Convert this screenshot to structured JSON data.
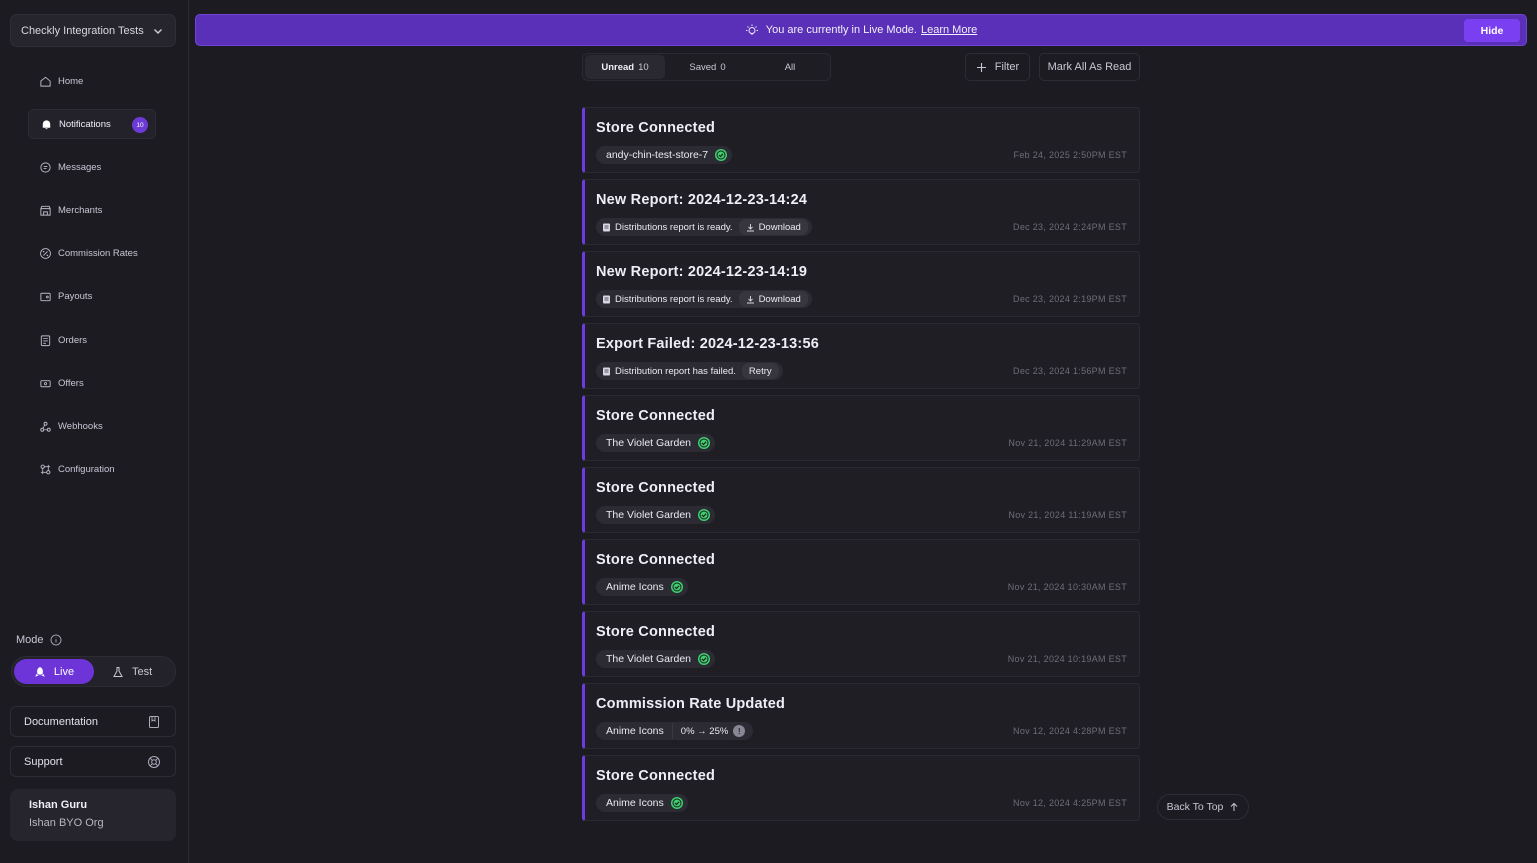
{
  "sidebar": {
    "org_name": "Checkly Integration Tests",
    "nav": [
      {
        "label": "Home",
        "icon": "home-icon"
      },
      {
        "label": "Notifications",
        "icon": "bell-icon",
        "badge": "10",
        "active": true
      },
      {
        "label": "Messages",
        "icon": "message-icon"
      },
      {
        "label": "Merchants",
        "icon": "store-icon"
      },
      {
        "label": "Commission Rates",
        "icon": "percent-icon"
      },
      {
        "label": "Payouts",
        "icon": "wallet-icon"
      },
      {
        "label": "Orders",
        "icon": "orders-icon"
      },
      {
        "label": "Offers",
        "icon": "ticket-icon"
      },
      {
        "label": "Webhooks",
        "icon": "webhook-icon"
      },
      {
        "label": "Configuration",
        "icon": "config-icon"
      }
    ],
    "mode_label": "Mode",
    "mode_live": "Live",
    "mode_test": "Test",
    "documentation": "Documentation",
    "support": "Support",
    "user_name": "Ishan Guru",
    "user_org": "Ishan BYO Org"
  },
  "banner": {
    "text": "You are currently in Live Mode.",
    "link": "Learn More",
    "hide": "Hide"
  },
  "toolbar": {
    "tab_unread": "Unread",
    "tab_unread_count": "10",
    "tab_saved": "Saved",
    "tab_saved_count": "0",
    "tab_all": "All",
    "filter": "Filter",
    "mark_all": "Mark All As Read"
  },
  "notifications": [
    {
      "title": "Store Connected",
      "chip": "andy-chin-test-store-7",
      "time": "Feb 24, 2025 2:50PM EST"
    },
    {
      "title": "New Report: 2024-12-23-14:24",
      "chip": "Distributions report is ready.",
      "action": "Download",
      "time": "Dec 23, 2024 2:24PM EST"
    },
    {
      "title": "New Report: 2024-12-23-14:19",
      "chip": "Distributions report is ready.",
      "action": "Download",
      "time": "Dec 23, 2024 2:19PM EST"
    },
    {
      "title": "Export Failed: 2024-12-23-13:56",
      "chip": "Distribution report has failed.",
      "action": "Retry",
      "time": "Dec 23, 2024 1:56PM EST"
    },
    {
      "title": "Store Connected",
      "chip": "The Violet Garden",
      "time": "Nov 21, 2024 11:29AM EST"
    },
    {
      "title": "Store Connected",
      "chip": "The Violet Garden",
      "time": "Nov 21, 2024 11:19AM EST"
    },
    {
      "title": "Store Connected",
      "chip": "Anime Icons",
      "time": "Nov 21, 2024 10:30AM EST"
    },
    {
      "title": "Store Connected",
      "chip": "The Violet Garden",
      "time": "Nov 21, 2024 10:19AM EST"
    },
    {
      "title": "Commission Rate Updated",
      "chip": "Anime Icons",
      "rate": "0% → 25%",
      "time": "Nov 12, 2024 4:28PM EST"
    },
    {
      "title": "Store Connected",
      "chip": "Anime Icons",
      "time": "Nov 12, 2024 4:25PM EST"
    }
  ],
  "back_to_top": "Back To Top",
  "colors": {
    "accent": "#6d35d8",
    "banner": "#5a30b8",
    "success": "#3ecf6e",
    "background": "#1c1b22"
  }
}
